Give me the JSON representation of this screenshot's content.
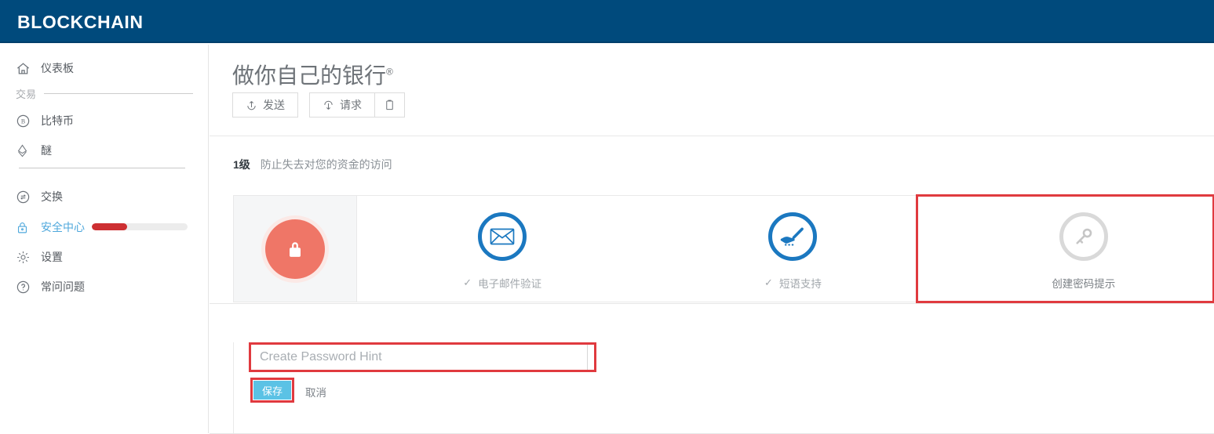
{
  "brand": {
    "name": "BLOCKCHAIN",
    "bg_color": "#004a7c"
  },
  "sidebar": {
    "items": [
      {
        "id": "dashboard",
        "label": "仪表板",
        "icon": "home-icon",
        "active": false
      },
      {
        "id": "bitcoin",
        "label": "比特币",
        "icon": "bitcoin-icon",
        "active": false
      },
      {
        "id": "ether",
        "label": "醚",
        "icon": "ethereum-icon",
        "active": false
      },
      {
        "id": "exchange",
        "label": "交换",
        "icon": "swap-icon",
        "active": false
      },
      {
        "id": "security",
        "label": "安全中心",
        "icon": "lock-icon",
        "active": true
      },
      {
        "id": "settings",
        "label": "设置",
        "icon": "gear-icon",
        "active": false
      },
      {
        "id": "faq",
        "label": "常问问题",
        "icon": "question-icon",
        "active": false
      }
    ],
    "group_label": "交易",
    "security_progress": {
      "percent": 37,
      "fill_color": "#cd2f32",
      "track_color": "#ececec"
    }
  },
  "main": {
    "title": "做你自己的银行",
    "title_mark": "®",
    "actions": {
      "send_label": "发送",
      "request_label": "请求",
      "send_icon": "arrow-up-circle-icon",
      "request_icon": "arrow-down-circle-icon",
      "clipboard_icon": "clipboard-icon"
    },
    "level": {
      "number": "1级",
      "description": "防止失去对您的资金的访问"
    },
    "steps": [
      {
        "id": "lock",
        "icon": "padlock-icon",
        "label": "",
        "state": "badge",
        "color": "#ef7667"
      },
      {
        "id": "email",
        "icon": "envelope-icon",
        "label": "电子邮件验证",
        "state": "done",
        "check": "✓"
      },
      {
        "id": "phrase",
        "icon": "signature-hand-icon",
        "label": "短语支持",
        "state": "done",
        "check": "✓"
      },
      {
        "id": "hint",
        "icon": "key-icon",
        "label": "创建密码提示",
        "state": "pending",
        "check": ""
      }
    ],
    "form": {
      "hint_placeholder": "Create Password Hint",
      "hint_value": "",
      "save_label": "保存",
      "cancel_label": "取消",
      "save_color": "#5bc2e5"
    },
    "highlight_color": "#e03a3f"
  }
}
